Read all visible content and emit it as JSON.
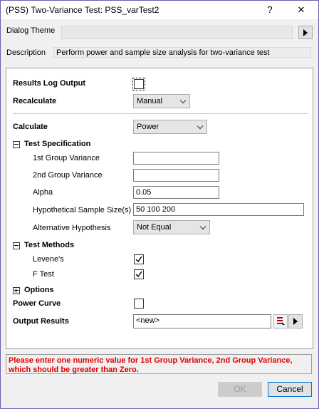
{
  "window": {
    "title": "(PSS) Two-Variance Test: PSS_varTest2",
    "help_label": "?",
    "close_label": "✕"
  },
  "dialog_theme": {
    "label": "Dialog Theme",
    "value": ""
  },
  "description": {
    "label": "Description",
    "value": "Perform power and sample size analysis for two-variance test"
  },
  "results_log_output": {
    "label": "Results Log Output",
    "checked": false
  },
  "recalculate": {
    "label": "Recalculate",
    "value": "Manual"
  },
  "calculate": {
    "label": "Calculate",
    "value": "Power"
  },
  "test_specification": {
    "label": "Test Specification",
    "expander": "−",
    "group1_variance": {
      "label": "1st Group Variance",
      "value": ""
    },
    "group2_variance": {
      "label": "2nd Group Variance",
      "value": ""
    },
    "alpha": {
      "label": "Alpha",
      "value": "0.05"
    },
    "sample_sizes": {
      "label": "Hypothetical Sample Size(s)",
      "value": "50 100 200"
    },
    "alternative": {
      "label": "Alternative Hypothesis",
      "value": "Not Equal"
    }
  },
  "test_methods": {
    "label": "Test Methods",
    "expander": "−",
    "levene": {
      "label": "Levene's",
      "checked": true
    },
    "ftest": {
      "label": "F Test",
      "checked": true
    }
  },
  "options": {
    "label": "Options",
    "expander": "+"
  },
  "power_curve": {
    "label": "Power Curve",
    "checked": false
  },
  "output_results": {
    "label": "Output Results",
    "value": "<new>"
  },
  "message": "Please enter one numeric value for 1st Group Variance, 2nd Group Variance, which should be greater than Zero.",
  "buttons": {
    "ok": "OK",
    "cancel": "Cancel"
  },
  "colors": {
    "error_text": "#e00000",
    "accent_border": "#6e5fb0"
  }
}
